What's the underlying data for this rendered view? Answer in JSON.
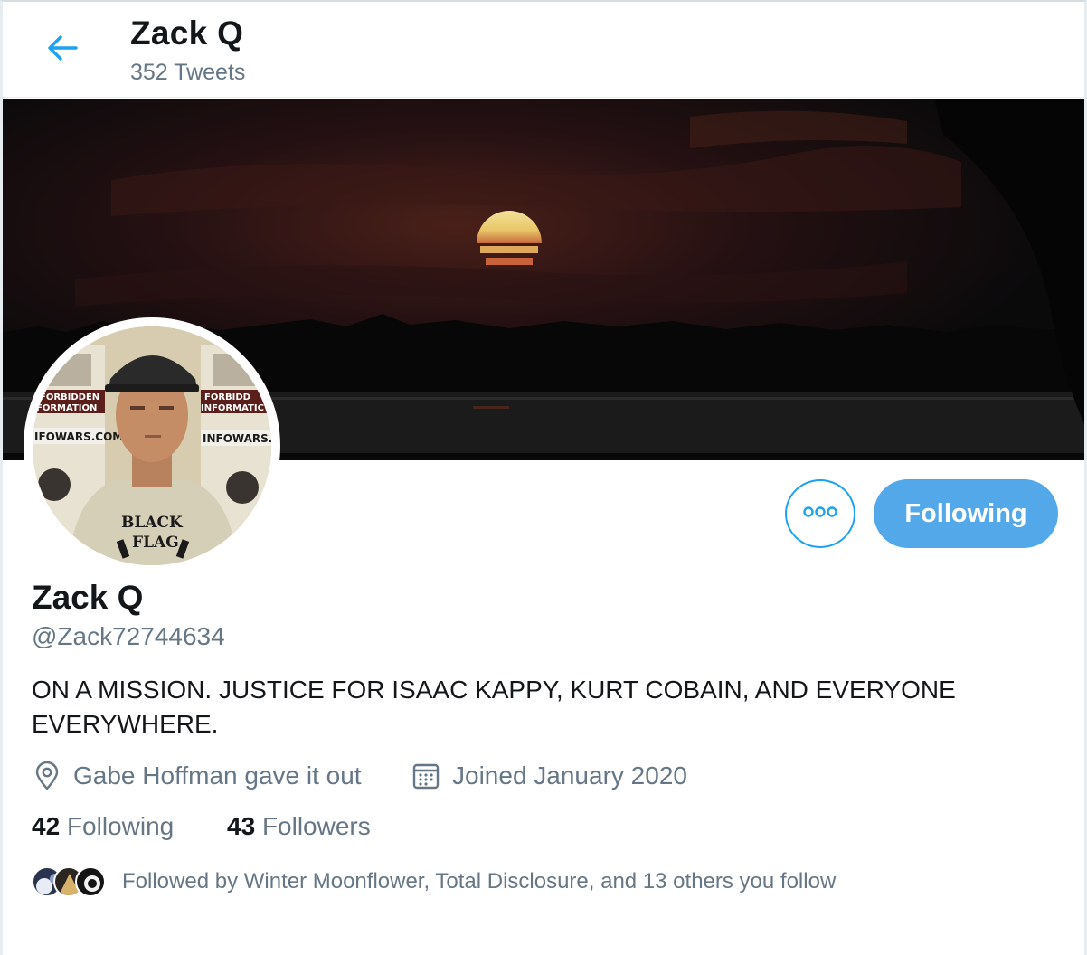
{
  "header": {
    "title": "Zack Q",
    "tweet_count": "352 Tweets"
  },
  "profile": {
    "name": "Zack Q",
    "handle": "@Zack72744634",
    "bio": "ON A MISSION. JUSTICE FOR ISAAC KAPPY, KURT COBAIN, AND EVERYONE EVERYWHERE.",
    "location": "Gabe Hoffman gave it out",
    "joined": "Joined January 2020",
    "following_count": "42",
    "following_label": "Following",
    "followers_count": "43",
    "followers_label": "Followers",
    "followed_by": "Followed by Winter Moonflower, Total Disclosure, and 13 others you follow"
  },
  "avatar_shirt": {
    "line1": "BLACK",
    "line2": "FLAG"
  },
  "avatar_poster": {
    "left_line1": "FORBIDDEN",
    "left_line2": "FORMATION",
    "left_site": "IFOWARS.COM",
    "right_line1": "FORBIDD",
    "right_line2": "INFORMATIC",
    "right_site": "INFOWARS.CO"
  },
  "actions": {
    "follow_label": "Following"
  },
  "colors": {
    "accent": "#1da1f2",
    "follow_button": "#53a8ea",
    "secondary_text": "#657786"
  },
  "icons": {
    "back": "arrow-left-icon",
    "more": "more-dots-icon",
    "location": "location-pin-icon",
    "calendar": "calendar-icon"
  }
}
